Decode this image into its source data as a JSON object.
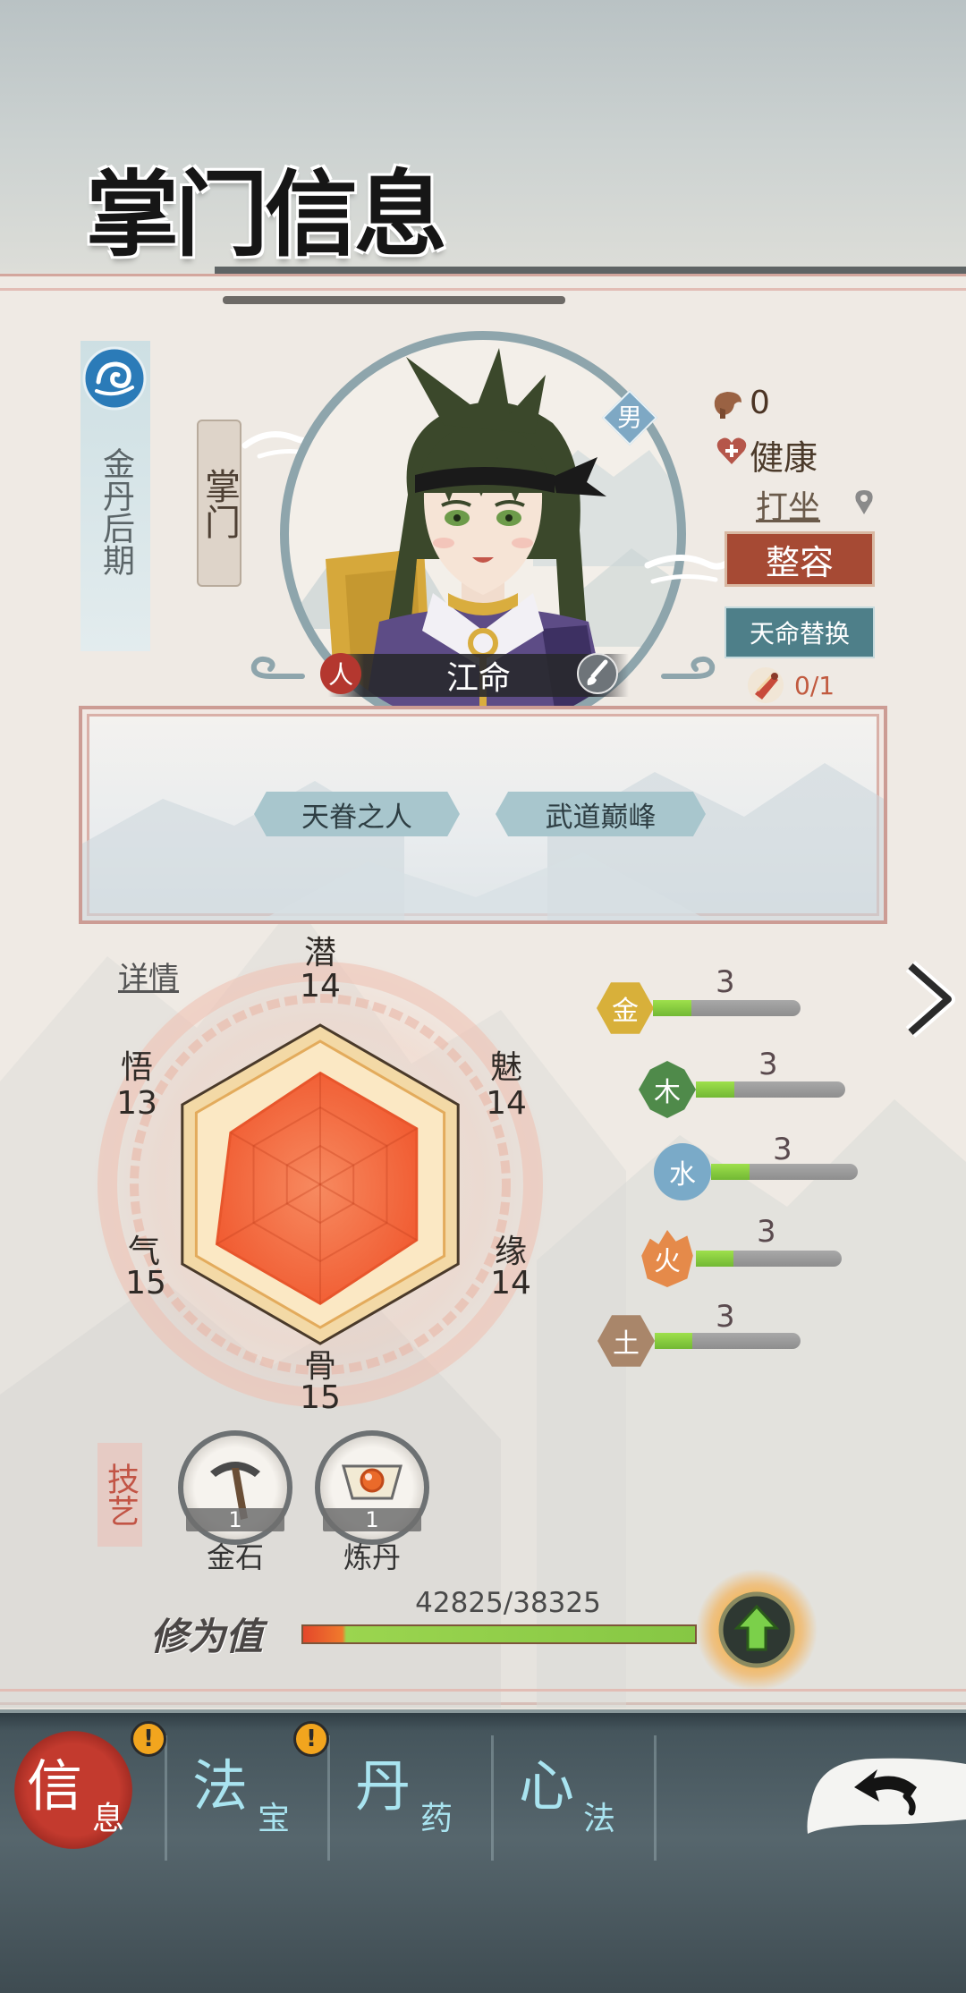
{
  "header": {
    "title": "掌门信息"
  },
  "profile": {
    "realm": "金丹后期",
    "role": "掌门",
    "gender": "男",
    "race": "人",
    "name": "江命",
    "resource_count": "0",
    "health": "健康",
    "activity": "打坐",
    "reshape_button": "整容",
    "destiny_button": "天命替换",
    "destiny_scroll_count": "0/1"
  },
  "traits": [
    "天眷之人",
    "武道巅峰"
  ],
  "attributes": {
    "details_link": "详情",
    "items": [
      {
        "label": "潜",
        "value": 14
      },
      {
        "label": "魅",
        "value": 14
      },
      {
        "label": "缘",
        "value": 14
      },
      {
        "label": "骨",
        "value": 15
      },
      {
        "label": "气",
        "value": 15
      },
      {
        "label": "悟",
        "value": 13
      }
    ]
  },
  "elements": [
    {
      "label": "金",
      "value": "3",
      "fill": 0.26,
      "color": "#d8b03a"
    },
    {
      "label": "木",
      "value": "3",
      "fill": 0.26,
      "color": "#4f8a4a"
    },
    {
      "label": "水",
      "value": "3",
      "fill": 0.26,
      "color": "#7aaac8"
    },
    {
      "label": "火",
      "value": "3",
      "fill": 0.26,
      "color": "#e58a4a"
    },
    {
      "label": "土",
      "value": "3",
      "fill": 0.26,
      "color": "#a9866a"
    }
  ],
  "skills": {
    "title": "技艺",
    "items": [
      {
        "label": "金石",
        "level": "1",
        "icon": "pickaxe-icon"
      },
      {
        "label": "炼丹",
        "level": "1",
        "icon": "alchemy-icon"
      }
    ]
  },
  "cultivation": {
    "label": "修为值",
    "value": "42825/38325",
    "current": 42825,
    "max": 38325
  },
  "nav": {
    "alert_mark": "!",
    "tabs": [
      {
        "main": "信",
        "sub": "息",
        "selected": true,
        "alert": true
      },
      {
        "main": "法",
        "sub": "宝",
        "selected": false,
        "alert": true
      },
      {
        "main": "丹",
        "sub": "药",
        "selected": false,
        "alert": false
      },
      {
        "main": "心",
        "sub": "法",
        "selected": false,
        "alert": false
      }
    ]
  },
  "icons": {
    "realm": "water-swirl-icon",
    "resource": "pouch-icon",
    "health": "heart-icon",
    "location": "map-pin-icon",
    "destiny_scroll": "scroll-icon",
    "edit_name": "brush-icon",
    "next": "chevron-right-icon",
    "upgrade": "up-arrow-icon",
    "back": "back-arrow-icon"
  },
  "colors": {
    "accent_red": "#a64a34",
    "accent_teal": "#4e7f89",
    "radar_fill": "#f2643a",
    "progress_green": "#86c744"
  }
}
